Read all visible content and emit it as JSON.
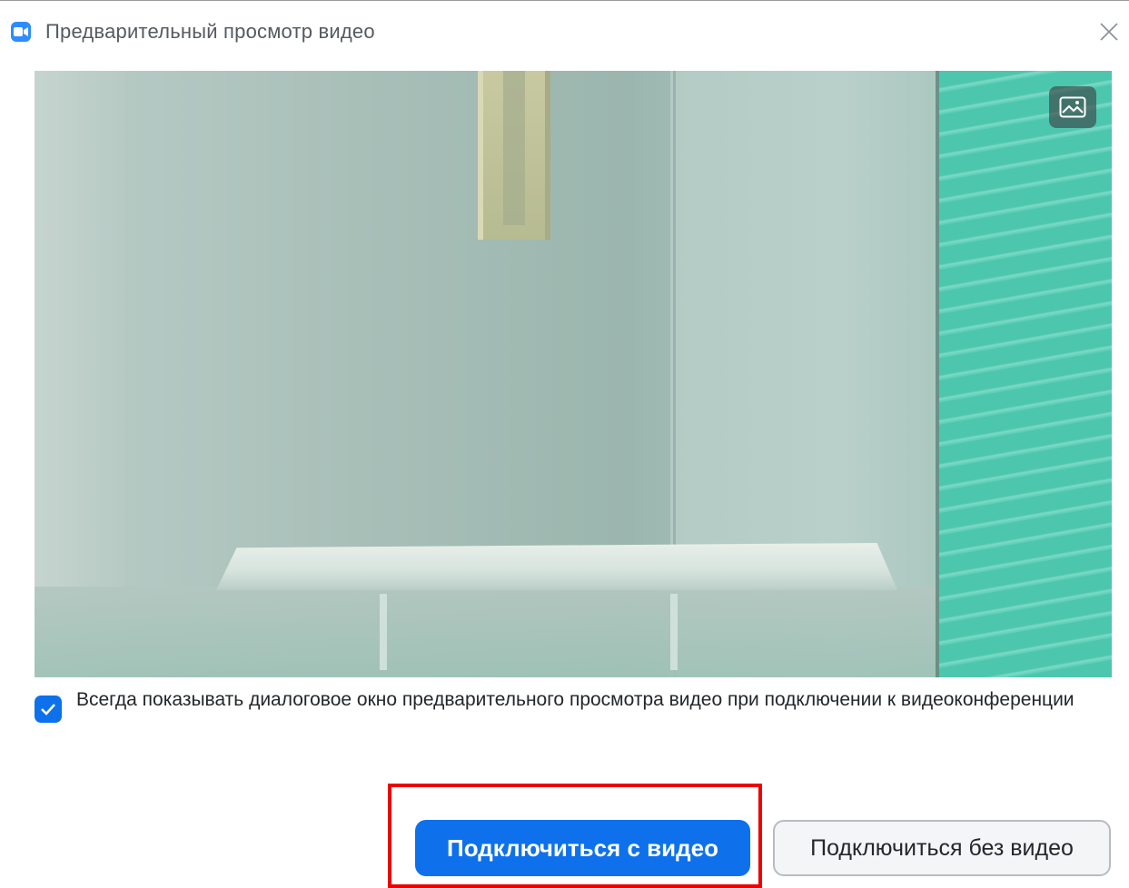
{
  "window": {
    "title": "Предварительный просмотр видео",
    "app_icon": "camera-icon",
    "close_icon": "close-icon"
  },
  "video": {
    "background_toggle_icon": "image-icon"
  },
  "preview_option": {
    "checked": true,
    "label": "Всегда показывать диалоговое окно предварительного просмотра видео при подключении к видеоконференции"
  },
  "actions": {
    "join_with_video": "Подключиться с видео",
    "join_without_video": "Подключиться без видео"
  },
  "colors": {
    "accent": "#0E71EB",
    "highlight": "#ee0000"
  }
}
